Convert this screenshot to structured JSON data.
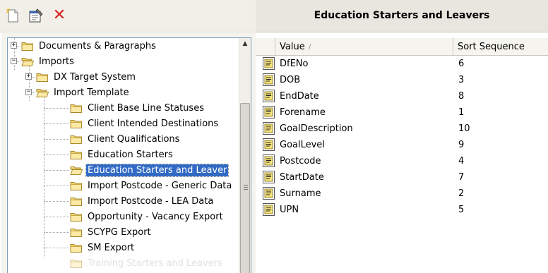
{
  "toolbar": {
    "new_icon": "new-document-icon",
    "properties_icon": "properties-icon",
    "delete_icon": "delete-icon",
    "delete_glyph": "✕",
    "delete_color": "#d8201c"
  },
  "header": {
    "title": "Education Starters and Leavers"
  },
  "tree": {
    "selected_color": "#316ac5",
    "nodes": [
      {
        "label": "Documents & Paragraphs",
        "expander": "+"
      },
      {
        "label": "Imports",
        "expander": "−"
      },
      {
        "label": "DX Target System",
        "expander": "+"
      },
      {
        "label": "Import Template",
        "expander": "−"
      },
      {
        "label": "Client Base Line Statuses"
      },
      {
        "label": "Client Intended Destinations"
      },
      {
        "label": "Client Qualifications"
      },
      {
        "label": "Education Starters"
      },
      {
        "label": "Education Starters and Leaver",
        "selected": true
      },
      {
        "label": "Import Postcode - Generic Data"
      },
      {
        "label": "Import Postcode - LEA Data"
      },
      {
        "label": "Opportunity - Vacancy Export"
      },
      {
        "label": "SCYPG Export"
      },
      {
        "label": "SM Export"
      },
      {
        "label": "Training Starters and Leavers",
        "faded": true
      }
    ]
  },
  "grid": {
    "columns": {
      "value": "Value",
      "sort_indicator": "/",
      "sort_sequence": "Sort Sequence"
    },
    "rows": [
      {
        "value": "DfENo",
        "sort": "6"
      },
      {
        "value": "DOB",
        "sort": "3"
      },
      {
        "value": "EndDate",
        "sort": "8"
      },
      {
        "value": "Forename",
        "sort": "1"
      },
      {
        "value": "GoalDescription",
        "sort": "10"
      },
      {
        "value": "GoalLevel",
        "sort": "9"
      },
      {
        "value": "Postcode",
        "sort": "4"
      },
      {
        "value": "StartDate",
        "sort": "7"
      },
      {
        "value": "Surname",
        "sort": "2"
      },
      {
        "value": "UPN",
        "sort": "5"
      }
    ]
  }
}
